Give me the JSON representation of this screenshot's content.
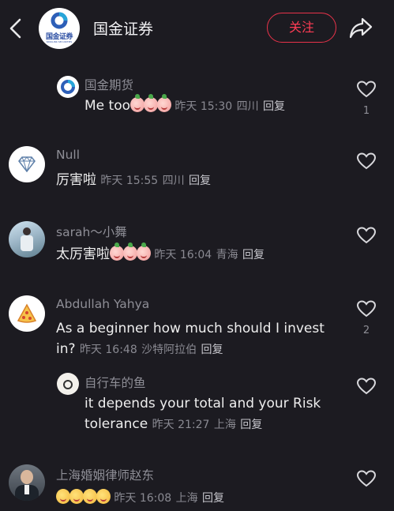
{
  "header": {
    "back_icon": "chevron-left-icon",
    "logo_text": "国金证券",
    "logo_subtext": "SINOLINK SECURITIES",
    "title": "国金证券",
    "follow_label": "关注",
    "share_icon": "share-arrow-icon"
  },
  "comments": [
    {
      "name": "国金期货",
      "text": "Me too",
      "emoji_count": 3,
      "emoji": "pig-face",
      "time": "昨天 15:30",
      "location": "四川",
      "reply_label": "回复",
      "likes": "1",
      "is_reply": true
    },
    {
      "name": "Null",
      "text": "厉害啦",
      "time": "昨天 15:55",
      "location": "四川",
      "reply_label": "回复",
      "likes": "",
      "avatar_icon": "diamond-icon"
    },
    {
      "name": "sarah～小舞",
      "text": "太厉害啦",
      "emoji_count": 3,
      "emoji": "pig-face",
      "time": "昨天 16:04",
      "location": "青海",
      "reply_label": "回复",
      "likes": ""
    },
    {
      "name": "Abdullah Yahya",
      "text_line1": "As a beginner how much should I invest",
      "text_line2": "in?",
      "time": "昨天 16:48",
      "location": "沙特阿拉伯",
      "reply_label": "回复",
      "likes": "2",
      "avatar_icon": "pizza-icon"
    },
    {
      "name": "自行车的鱼",
      "text_line1": "it depends your total and your Risk",
      "text_line2": "tolerance",
      "time": "昨天 21:27",
      "location": "上海",
      "reply_label": "回复",
      "likes": "",
      "is_reply": true
    },
    {
      "name": "上海婚姻律师赵东",
      "emoji_count": 4,
      "emoji": "laughing-face",
      "time": "昨天 16:08",
      "location": "上海",
      "reply_label": "回复",
      "likes": ""
    }
  ],
  "colors": {
    "background": "#1c1b21",
    "follow_accent": "#ff3c54",
    "muted_text": "#8e8e96"
  }
}
